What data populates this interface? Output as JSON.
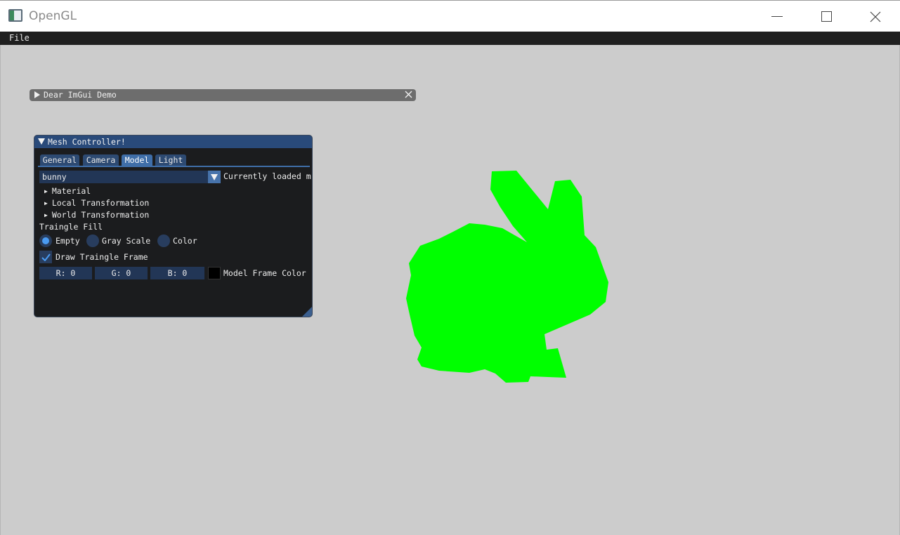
{
  "window": {
    "title": "OpenGL"
  },
  "menubar": {
    "file_label": "File"
  },
  "demo_window": {
    "title": "Dear ImGui Demo"
  },
  "mesh_controller": {
    "title": "Mesh Controller!",
    "tabs": [
      {
        "label": "General"
      },
      {
        "label": "Camera"
      },
      {
        "label": "Model",
        "active": true
      },
      {
        "label": "Light"
      }
    ],
    "model_select": {
      "value": "bunny",
      "label": "Currently loaded m"
    },
    "tree_nodes": [
      {
        "label": "Material"
      },
      {
        "label": "Local Transformation"
      },
      {
        "label": "World Transformation"
      }
    ],
    "fill_section_label": "Traingle Fill",
    "fill_options": [
      {
        "label": "Empty",
        "selected": true
      },
      {
        "label": "Gray Scale",
        "selected": false
      },
      {
        "label": "Color",
        "selected": false
      }
    ],
    "draw_frame": {
      "label": "Draw Traingle Frame",
      "checked": true
    },
    "frame_color": {
      "r": "R:  0",
      "g": "G:  0",
      "b": "B:  0",
      "label": "Model Frame Color",
      "swatch": "#000000"
    }
  },
  "scene": {
    "model_color": "#00ff00",
    "background": "#cccccc"
  }
}
